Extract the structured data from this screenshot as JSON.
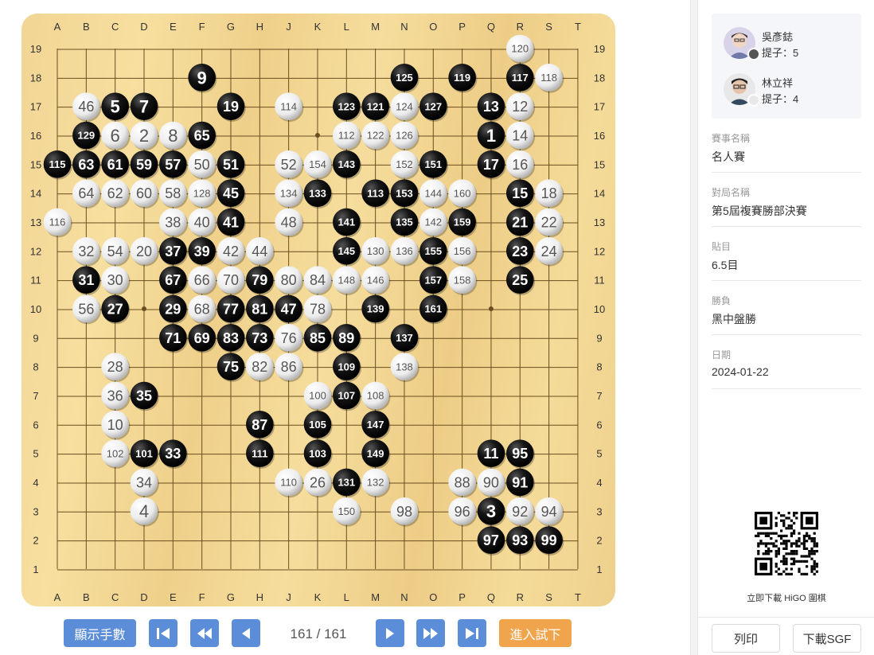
{
  "board": {
    "size": 19,
    "columns": [
      "A",
      "B",
      "C",
      "D",
      "E",
      "F",
      "G",
      "H",
      "J",
      "K",
      "L",
      "M",
      "N",
      "O",
      "P",
      "Q",
      "R",
      "S",
      "T"
    ],
    "rows": [
      "19",
      "18",
      "17",
      "16",
      "15",
      "14",
      "13",
      "12",
      "11",
      "10",
      "9",
      "8",
      "7",
      "6",
      "5",
      "4",
      "3",
      "2",
      "1"
    ],
    "stones": [
      {
        "c": "R",
        "r": 19,
        "color": "W",
        "n": "120"
      },
      {
        "c": "F",
        "r": 18,
        "color": "B",
        "n": "9"
      },
      {
        "c": "N",
        "r": 18,
        "color": "B",
        "n": "125"
      },
      {
        "c": "P",
        "r": 18,
        "color": "B",
        "n": "119"
      },
      {
        "c": "R",
        "r": 18,
        "color": "B",
        "n": "117"
      },
      {
        "c": "S",
        "r": 18,
        "color": "W",
        "n": "118"
      },
      {
        "c": "B",
        "r": 17,
        "color": "W",
        "n": "46"
      },
      {
        "c": "C",
        "r": 17,
        "color": "B",
        "n": "5"
      },
      {
        "c": "D",
        "r": 17,
        "color": "B",
        "n": "7"
      },
      {
        "c": "G",
        "r": 17,
        "color": "B",
        "n": "19"
      },
      {
        "c": "J",
        "r": 17,
        "color": "W",
        "n": "114"
      },
      {
        "c": "L",
        "r": 17,
        "color": "B",
        "n": "123"
      },
      {
        "c": "M",
        "r": 17,
        "color": "B",
        "n": "121"
      },
      {
        "c": "N",
        "r": 17,
        "color": "W",
        "n": "124"
      },
      {
        "c": "O",
        "r": 17,
        "color": "B",
        "n": "127"
      },
      {
        "c": "Q",
        "r": 17,
        "color": "B",
        "n": "13"
      },
      {
        "c": "R",
        "r": 17,
        "color": "W",
        "n": "12"
      },
      {
        "c": "B",
        "r": 16,
        "color": "B",
        "n": "129"
      },
      {
        "c": "C",
        "r": 16,
        "color": "W",
        "n": "6"
      },
      {
        "c": "D",
        "r": 16,
        "color": "W",
        "n": "2"
      },
      {
        "c": "E",
        "r": 16,
        "color": "W",
        "n": "8"
      },
      {
        "c": "F",
        "r": 16,
        "color": "B",
        "n": "65"
      },
      {
        "c": "L",
        "r": 16,
        "color": "W",
        "n": "112"
      },
      {
        "c": "M",
        "r": 16,
        "color": "W",
        "n": "122"
      },
      {
        "c": "N",
        "r": 16,
        "color": "W",
        "n": "126"
      },
      {
        "c": "Q",
        "r": 16,
        "color": "B",
        "n": "1"
      },
      {
        "c": "R",
        "r": 16,
        "color": "W",
        "n": "14"
      },
      {
        "c": "A",
        "r": 15,
        "color": "B",
        "n": "115"
      },
      {
        "c": "B",
        "r": 15,
        "color": "B",
        "n": "63"
      },
      {
        "c": "C",
        "r": 15,
        "color": "B",
        "n": "61"
      },
      {
        "c": "D",
        "r": 15,
        "color": "B",
        "n": "59"
      },
      {
        "c": "E",
        "r": 15,
        "color": "B",
        "n": "57"
      },
      {
        "c": "F",
        "r": 15,
        "color": "W",
        "n": "50"
      },
      {
        "c": "G",
        "r": 15,
        "color": "B",
        "n": "51"
      },
      {
        "c": "J",
        "r": 15,
        "color": "W",
        "n": "52"
      },
      {
        "c": "K",
        "r": 15,
        "color": "W",
        "n": "154"
      },
      {
        "c": "L",
        "r": 15,
        "color": "B",
        "n": "143"
      },
      {
        "c": "N",
        "r": 15,
        "color": "W",
        "n": "152"
      },
      {
        "c": "O",
        "r": 15,
        "color": "B",
        "n": "151"
      },
      {
        "c": "Q",
        "r": 15,
        "color": "B",
        "n": "17"
      },
      {
        "c": "R",
        "r": 15,
        "color": "W",
        "n": "16"
      },
      {
        "c": "B",
        "r": 14,
        "color": "W",
        "n": "64"
      },
      {
        "c": "C",
        "r": 14,
        "color": "W",
        "n": "62"
      },
      {
        "c": "D",
        "r": 14,
        "color": "W",
        "n": "60"
      },
      {
        "c": "E",
        "r": 14,
        "color": "W",
        "n": "58"
      },
      {
        "c": "F",
        "r": 14,
        "color": "W",
        "n": "128"
      },
      {
        "c": "G",
        "r": 14,
        "color": "B",
        "n": "45"
      },
      {
        "c": "J",
        "r": 14,
        "color": "W",
        "n": "134"
      },
      {
        "c": "K",
        "r": 14,
        "color": "B",
        "n": "133"
      },
      {
        "c": "M",
        "r": 14,
        "color": "B",
        "n": "113"
      },
      {
        "c": "N",
        "r": 14,
        "color": "B",
        "n": "153"
      },
      {
        "c": "O",
        "r": 14,
        "color": "W",
        "n": "144"
      },
      {
        "c": "P",
        "r": 14,
        "color": "W",
        "n": "160"
      },
      {
        "c": "R",
        "r": 14,
        "color": "B",
        "n": "15"
      },
      {
        "c": "S",
        "r": 14,
        "color": "W",
        "n": "18"
      },
      {
        "c": "A",
        "r": 13,
        "color": "W",
        "n": "116"
      },
      {
        "c": "E",
        "r": 13,
        "color": "W",
        "n": "38"
      },
      {
        "c": "F",
        "r": 13,
        "color": "W",
        "n": "40"
      },
      {
        "c": "G",
        "r": 13,
        "color": "B",
        "n": "41"
      },
      {
        "c": "J",
        "r": 13,
        "color": "W",
        "n": "48"
      },
      {
        "c": "L",
        "r": 13,
        "color": "B",
        "n": "141"
      },
      {
        "c": "N",
        "r": 13,
        "color": "B",
        "n": "135"
      },
      {
        "c": "O",
        "r": 13,
        "color": "W",
        "n": "142"
      },
      {
        "c": "P",
        "r": 13,
        "color": "B",
        "n": "159"
      },
      {
        "c": "R",
        "r": 13,
        "color": "B",
        "n": "21"
      },
      {
        "c": "S",
        "r": 13,
        "color": "W",
        "n": "22"
      },
      {
        "c": "B",
        "r": 12,
        "color": "W",
        "n": "32"
      },
      {
        "c": "C",
        "r": 12,
        "color": "W",
        "n": "54"
      },
      {
        "c": "D",
        "r": 12,
        "color": "W",
        "n": "20"
      },
      {
        "c": "E",
        "r": 12,
        "color": "B",
        "n": "37"
      },
      {
        "c": "F",
        "r": 12,
        "color": "B",
        "n": "39"
      },
      {
        "c": "G",
        "r": 12,
        "color": "W",
        "n": "42"
      },
      {
        "c": "H",
        "r": 12,
        "color": "W",
        "n": "44"
      },
      {
        "c": "L",
        "r": 12,
        "color": "B",
        "n": "145"
      },
      {
        "c": "M",
        "r": 12,
        "color": "W",
        "n": "130"
      },
      {
        "c": "N",
        "r": 12,
        "color": "W",
        "n": "136"
      },
      {
        "c": "O",
        "r": 12,
        "color": "B",
        "n": "155"
      },
      {
        "c": "P",
        "r": 12,
        "color": "W",
        "n": "156"
      },
      {
        "c": "R",
        "r": 12,
        "color": "B",
        "n": "23"
      },
      {
        "c": "S",
        "r": 12,
        "color": "W",
        "n": "24"
      },
      {
        "c": "B",
        "r": 11,
        "color": "B",
        "n": "31"
      },
      {
        "c": "C",
        "r": 11,
        "color": "W",
        "n": "30"
      },
      {
        "c": "E",
        "r": 11,
        "color": "B",
        "n": "67"
      },
      {
        "c": "F",
        "r": 11,
        "color": "W",
        "n": "66"
      },
      {
        "c": "G",
        "r": 11,
        "color": "W",
        "n": "70"
      },
      {
        "c": "H",
        "r": 11,
        "color": "B",
        "n": "79"
      },
      {
        "c": "J",
        "r": 11,
        "color": "W",
        "n": "80"
      },
      {
        "c": "K",
        "r": 11,
        "color": "W",
        "n": "84"
      },
      {
        "c": "L",
        "r": 11,
        "color": "W",
        "n": "148"
      },
      {
        "c": "M",
        "r": 11,
        "color": "W",
        "n": "146"
      },
      {
        "c": "O",
        "r": 11,
        "color": "B",
        "n": "157"
      },
      {
        "c": "P",
        "r": 11,
        "color": "W",
        "n": "158"
      },
      {
        "c": "R",
        "r": 11,
        "color": "B",
        "n": "25"
      },
      {
        "c": "B",
        "r": 10,
        "color": "W",
        "n": "56"
      },
      {
        "c": "C",
        "r": 10,
        "color": "B",
        "n": "27"
      },
      {
        "c": "E",
        "r": 10,
        "color": "B",
        "n": "29"
      },
      {
        "c": "F",
        "r": 10,
        "color": "W",
        "n": "68"
      },
      {
        "c": "G",
        "r": 10,
        "color": "B",
        "n": "77"
      },
      {
        "c": "H",
        "r": 10,
        "color": "B",
        "n": "81"
      },
      {
        "c": "J",
        "r": 10,
        "color": "B",
        "n": "47"
      },
      {
        "c": "K",
        "r": 10,
        "color": "W",
        "n": "78"
      },
      {
        "c": "M",
        "r": 10,
        "color": "B",
        "n": "139"
      },
      {
        "c": "O",
        "r": 10,
        "color": "B",
        "n": "161"
      },
      {
        "c": "E",
        "r": 9,
        "color": "B",
        "n": "71"
      },
      {
        "c": "F",
        "r": 9,
        "color": "B",
        "n": "69"
      },
      {
        "c": "G",
        "r": 9,
        "color": "B",
        "n": "83"
      },
      {
        "c": "H",
        "r": 9,
        "color": "B",
        "n": "73"
      },
      {
        "c": "J",
        "r": 9,
        "color": "W",
        "n": "76"
      },
      {
        "c": "K",
        "r": 9,
        "color": "B",
        "n": "85"
      },
      {
        "c": "L",
        "r": 9,
        "color": "B",
        "n": "89"
      },
      {
        "c": "N",
        "r": 9,
        "color": "B",
        "n": "137"
      },
      {
        "c": "C",
        "r": 8,
        "color": "W",
        "n": "28"
      },
      {
        "c": "G",
        "r": 8,
        "color": "B",
        "n": "75"
      },
      {
        "c": "H",
        "r": 8,
        "color": "W",
        "n": "82"
      },
      {
        "c": "J",
        "r": 8,
        "color": "W",
        "n": "86"
      },
      {
        "c": "L",
        "r": 8,
        "color": "B",
        "n": "109"
      },
      {
        "c": "N",
        "r": 8,
        "color": "W",
        "n": "138"
      },
      {
        "c": "C",
        "r": 7,
        "color": "W",
        "n": "36"
      },
      {
        "c": "D",
        "r": 7,
        "color": "B",
        "n": "35"
      },
      {
        "c": "K",
        "r": 7,
        "color": "W",
        "n": "100"
      },
      {
        "c": "L",
        "r": 7,
        "color": "B",
        "n": "107"
      },
      {
        "c": "M",
        "r": 7,
        "color": "W",
        "n": "108"
      },
      {
        "c": "C",
        "r": 6,
        "color": "W",
        "n": "10"
      },
      {
        "c": "H",
        "r": 6,
        "color": "B",
        "n": "87"
      },
      {
        "c": "K",
        "r": 6,
        "color": "B",
        "n": "105"
      },
      {
        "c": "M",
        "r": 6,
        "color": "B",
        "n": "147"
      },
      {
        "c": "C",
        "r": 5,
        "color": "W",
        "n": "102"
      },
      {
        "c": "D",
        "r": 5,
        "color": "B",
        "n": "101"
      },
      {
        "c": "E",
        "r": 5,
        "color": "B",
        "n": "33"
      },
      {
        "c": "H",
        "r": 5,
        "color": "B",
        "n": "111"
      },
      {
        "c": "K",
        "r": 5,
        "color": "B",
        "n": "103"
      },
      {
        "c": "M",
        "r": 5,
        "color": "B",
        "n": "149"
      },
      {
        "c": "Q",
        "r": 5,
        "color": "B",
        "n": "11"
      },
      {
        "c": "R",
        "r": 5,
        "color": "B",
        "n": "95"
      },
      {
        "c": "D",
        "r": 4,
        "color": "W",
        "n": "34"
      },
      {
        "c": "J",
        "r": 4,
        "color": "W",
        "n": "110"
      },
      {
        "c": "K",
        "r": 4,
        "color": "W",
        "n": "26"
      },
      {
        "c": "L",
        "r": 4,
        "color": "B",
        "n": "131"
      },
      {
        "c": "M",
        "r": 4,
        "color": "W",
        "n": "132"
      },
      {
        "c": "P",
        "r": 4,
        "color": "W",
        "n": "88"
      },
      {
        "c": "Q",
        "r": 4,
        "color": "W",
        "n": "90"
      },
      {
        "c": "R",
        "r": 4,
        "color": "B",
        "n": "91"
      },
      {
        "c": "D",
        "r": 3,
        "color": "W",
        "n": "4"
      },
      {
        "c": "L",
        "r": 3,
        "color": "W",
        "n": "150"
      },
      {
        "c": "N",
        "r": 3,
        "color": "W",
        "n": "98"
      },
      {
        "c": "P",
        "r": 3,
        "color": "W",
        "n": "96"
      },
      {
        "c": "Q",
        "r": 3,
        "color": "B",
        "n": "3"
      },
      {
        "c": "R",
        "r": 3,
        "color": "W",
        "n": "92"
      },
      {
        "c": "S",
        "r": 3,
        "color": "W",
        "n": "94"
      },
      {
        "c": "Q",
        "r": 2,
        "color": "B",
        "n": "97"
      },
      {
        "c": "R",
        "r": 2,
        "color": "B",
        "n": "93"
      },
      {
        "c": "S",
        "r": 2,
        "color": "B",
        "n": "99"
      }
    ]
  },
  "controls": {
    "show_moves_label": "顯示手數",
    "move_counter": "161 / 161",
    "try_label": "進入試下"
  },
  "players": [
    {
      "name": "吳彥鋕",
      "captures": "提子：5",
      "stone": "black"
    },
    {
      "name": "林立祥",
      "captures": "提子：4",
      "stone": "white"
    }
  ],
  "info": [
    {
      "label": "賽事名稱",
      "value": "名人賽"
    },
    {
      "label": "對局名稱",
      "value": "第5屆複賽勝部決賽"
    },
    {
      "label": "貼目",
      "value": "6.5目"
    },
    {
      "label": "勝負",
      "value": "黑中盤勝"
    },
    {
      "label": "日期",
      "value": "2024-01-22"
    }
  ],
  "qr_caption": "立即下載 HiGO 圍棋",
  "bottom": {
    "print_label": "列印",
    "download_label": "下載SGF"
  },
  "colors": {
    "accent_blue": "#5b8dd9",
    "accent_orange": "#f0a44b",
    "black_stone": "#111111",
    "white_stone": "#f0f0f0"
  }
}
